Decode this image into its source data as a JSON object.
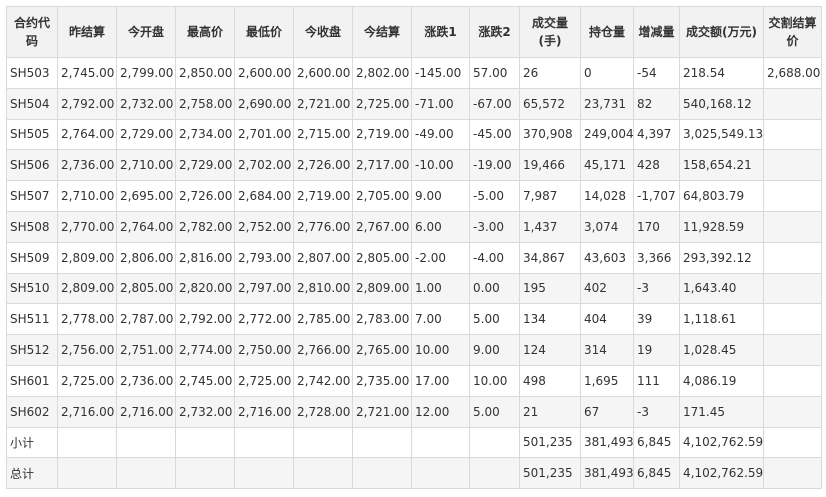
{
  "table": {
    "headers": [
      "合约代码",
      "昨结算",
      "今开盘",
      "最高价",
      "最低价",
      "今收盘",
      "今结算",
      "涨跌1",
      "涨跌2",
      "成交量(手)",
      "持仓量",
      "增减量",
      "成交额(万元)",
      "交割结算价"
    ],
    "rows": [
      [
        "SH503",
        "2,745.00",
        "2,799.00",
        "2,850.00",
        "2,600.00",
        "2,600.00",
        "2,802.00",
        "-145.00",
        "57.00",
        "26",
        "0",
        "-54",
        "218.54",
        "2,688.00"
      ],
      [
        "SH504",
        "2,792.00",
        "2,732.00",
        "2,758.00",
        "2,690.00",
        "2,721.00",
        "2,725.00",
        "-71.00",
        "-67.00",
        "65,572",
        "23,731",
        "82",
        "540,168.12",
        ""
      ],
      [
        "SH505",
        "2,764.00",
        "2,729.00",
        "2,734.00",
        "2,701.00",
        "2,715.00",
        "2,719.00",
        "-49.00",
        "-45.00",
        "370,908",
        "249,004",
        "4,397",
        "3,025,549.13",
        ""
      ],
      [
        "SH506",
        "2,736.00",
        "2,710.00",
        "2,729.00",
        "2,702.00",
        "2,726.00",
        "2,717.00",
        "-10.00",
        "-19.00",
        "19,466",
        "45,171",
        "428",
        "158,654.21",
        ""
      ],
      [
        "SH507",
        "2,710.00",
        "2,695.00",
        "2,726.00",
        "2,684.00",
        "2,719.00",
        "2,705.00",
        "9.00",
        "-5.00",
        "7,987",
        "14,028",
        "-1,707",
        "64,803.79",
        ""
      ],
      [
        "SH508",
        "2,770.00",
        "2,764.00",
        "2,782.00",
        "2,752.00",
        "2,776.00",
        "2,767.00",
        "6.00",
        "-3.00",
        "1,437",
        "3,074",
        "170",
        "11,928.59",
        ""
      ],
      [
        "SH509",
        "2,809.00",
        "2,806.00",
        "2,816.00",
        "2,793.00",
        "2,807.00",
        "2,805.00",
        "-2.00",
        "-4.00",
        "34,867",
        "43,603",
        "3,366",
        "293,392.12",
        ""
      ],
      [
        "SH510",
        "2,809.00",
        "2,805.00",
        "2,820.00",
        "2,797.00",
        "2,810.00",
        "2,809.00",
        "1.00",
        "0.00",
        "195",
        "402",
        "-3",
        "1,643.40",
        ""
      ],
      [
        "SH511",
        "2,778.00",
        "2,787.00",
        "2,792.00",
        "2,772.00",
        "2,785.00",
        "2,783.00",
        "7.00",
        "5.00",
        "134",
        "404",
        "39",
        "1,118.61",
        ""
      ],
      [
        "SH512",
        "2,756.00",
        "2,751.00",
        "2,774.00",
        "2,750.00",
        "2,766.00",
        "2,765.00",
        "10.00",
        "9.00",
        "124",
        "314",
        "19",
        "1,028.45",
        ""
      ],
      [
        "SH601",
        "2,725.00",
        "2,736.00",
        "2,745.00",
        "2,725.00",
        "2,742.00",
        "2,735.00",
        "17.00",
        "10.00",
        "498",
        "1,695",
        "111",
        "4,086.19",
        ""
      ],
      [
        "SH602",
        "2,716.00",
        "2,716.00",
        "2,732.00",
        "2,716.00",
        "2,728.00",
        "2,721.00",
        "12.00",
        "5.00",
        "21",
        "67",
        "-3",
        "171.45",
        ""
      ],
      [
        "小计",
        "",
        "",
        "",
        "",
        "",
        "",
        "",
        "",
        "501,235",
        "381,493",
        "6,845",
        "4,102,762.59",
        ""
      ],
      [
        "总计",
        "",
        "",
        "",
        "",
        "",
        "",
        "",
        "",
        "501,235",
        "381,493",
        "6,845",
        "4,102,762.59",
        ""
      ]
    ]
  }
}
